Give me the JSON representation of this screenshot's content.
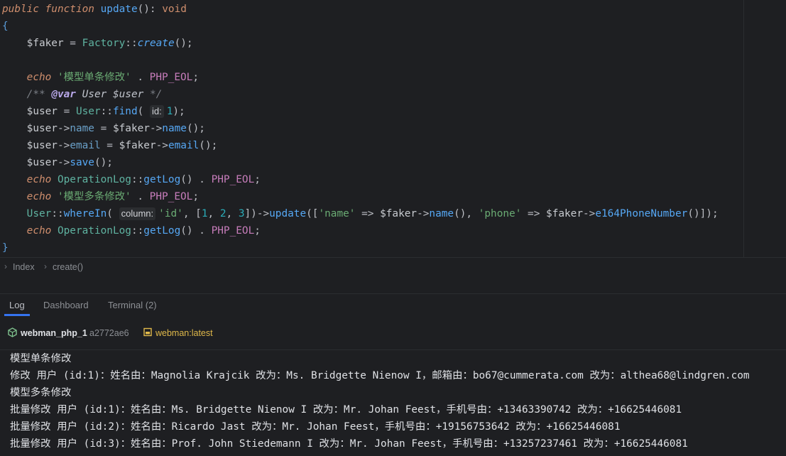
{
  "editor": {
    "lines": [
      [
        [
          "kw",
          "public function "
        ],
        [
          "fn",
          "update"
        ],
        [
          "op",
          "(): "
        ],
        [
          "tp",
          "void"
        ]
      ],
      [
        [
          "brace",
          "{"
        ]
      ],
      [
        [
          "op",
          "    "
        ],
        [
          "var",
          "$faker"
        ],
        [
          "op",
          " = "
        ],
        [
          "cls",
          "Factory"
        ],
        [
          "op",
          "::"
        ],
        [
          "smth",
          "create"
        ],
        [
          "op",
          "();"
        ]
      ],
      [],
      [
        [
          "op",
          "    "
        ],
        [
          "kw",
          "echo"
        ],
        [
          "op",
          " "
        ],
        [
          "str",
          "'模型单条修改'"
        ],
        [
          "op",
          " . "
        ],
        [
          "cst",
          "PHP_EOL"
        ],
        [
          "op",
          ";"
        ]
      ],
      [
        [
          "op",
          "    "
        ],
        [
          "cm",
          "/** "
        ],
        [
          "tag",
          "@var"
        ],
        [
          "cmtype",
          " User $user"
        ],
        [
          "cm",
          " */"
        ]
      ],
      [
        [
          "op",
          "    "
        ],
        [
          "var",
          "$user"
        ],
        [
          "op",
          " = "
        ],
        [
          "cls",
          "User"
        ],
        [
          "op",
          "::"
        ],
        [
          "mth",
          "find"
        ],
        [
          "op",
          "( "
        ],
        [
          "hint",
          "id:"
        ],
        [
          "num",
          "1"
        ],
        [
          "op",
          ");"
        ]
      ],
      [
        [
          "op",
          "    "
        ],
        [
          "var",
          "$user"
        ],
        [
          "arr",
          "->"
        ],
        [
          "prop",
          "name"
        ],
        [
          "op",
          " = "
        ],
        [
          "var",
          "$faker"
        ],
        [
          "arr",
          "->"
        ],
        [
          "mth",
          "name"
        ],
        [
          "op",
          "();"
        ]
      ],
      [
        [
          "op",
          "    "
        ],
        [
          "var",
          "$user"
        ],
        [
          "arr",
          "->"
        ],
        [
          "prop",
          "email"
        ],
        [
          "op",
          " = "
        ],
        [
          "var",
          "$faker"
        ],
        [
          "arr",
          "->"
        ],
        [
          "mth",
          "email"
        ],
        [
          "op",
          "();"
        ]
      ],
      [
        [
          "op",
          "    "
        ],
        [
          "var",
          "$user"
        ],
        [
          "arr",
          "->"
        ],
        [
          "mth",
          "save"
        ],
        [
          "op",
          "();"
        ]
      ],
      [
        [
          "op",
          "    "
        ],
        [
          "kw",
          "echo"
        ],
        [
          "op",
          " "
        ],
        [
          "cls",
          "OperationLog"
        ],
        [
          "op",
          "::"
        ],
        [
          "mth",
          "getLog"
        ],
        [
          "op",
          "() . "
        ],
        [
          "cst",
          "PHP_EOL"
        ],
        [
          "op",
          ";"
        ]
      ],
      [
        [
          "op",
          "    "
        ],
        [
          "kw",
          "echo"
        ],
        [
          "op",
          " "
        ],
        [
          "str",
          "'模型多条修改'"
        ],
        [
          "op",
          " . "
        ],
        [
          "cst",
          "PHP_EOL"
        ],
        [
          "op",
          ";"
        ]
      ],
      [
        [
          "op",
          "    "
        ],
        [
          "cls",
          "User"
        ],
        [
          "op",
          "::"
        ],
        [
          "mth",
          "whereIn"
        ],
        [
          "op",
          "( "
        ],
        [
          "hint",
          "column:"
        ],
        [
          "str",
          "'id'"
        ],
        [
          "op",
          ", ["
        ],
        [
          "num",
          "1"
        ],
        [
          "op",
          ", "
        ],
        [
          "num",
          "2"
        ],
        [
          "op",
          ", "
        ],
        [
          "num",
          "3"
        ],
        [
          "op",
          "])"
        ],
        [
          "arr",
          "->"
        ],
        [
          "mth",
          "update"
        ],
        [
          "op",
          "(["
        ],
        [
          "str",
          "'name'"
        ],
        [
          "op",
          " => "
        ],
        [
          "var",
          "$faker"
        ],
        [
          "arr",
          "->"
        ],
        [
          "mth",
          "name"
        ],
        [
          "op",
          "(), "
        ],
        [
          "str",
          "'phone'"
        ],
        [
          "op",
          " => "
        ],
        [
          "var",
          "$faker"
        ],
        [
          "arr",
          "->"
        ],
        [
          "mth",
          "e164PhoneNumber"
        ],
        [
          "op",
          "()]);"
        ]
      ],
      [
        [
          "op",
          "    "
        ],
        [
          "kw",
          "echo"
        ],
        [
          "op",
          " "
        ],
        [
          "cls",
          "OperationLog"
        ],
        [
          "op",
          "::"
        ],
        [
          "mth",
          "getLog"
        ],
        [
          "op",
          "() . "
        ],
        [
          "cst",
          "PHP_EOL"
        ],
        [
          "op",
          ";"
        ]
      ],
      [
        [
          "brace",
          "}"
        ]
      ]
    ]
  },
  "breadcrumb": {
    "items": [
      "Index",
      "create()"
    ]
  },
  "toolbar": {
    "tabs": [
      "Log",
      "Dashboard",
      "Terminal (2)"
    ],
    "active": 0
  },
  "panel": {
    "container_name": "webman_php_1",
    "container_id": "a2772ae6",
    "image_name": "webman:latest"
  },
  "log": {
    "lines": [
      "模型单条修改",
      "修改 用户 (id:1)：姓名由：Magnolia Krajcik 改为：Ms. Bridgette Nienow I，邮箱由：bo67@cummerata.com 改为：althea68@lindgren.com",
      "模型多条修改",
      "批量修改 用户 (id:1)：姓名由：Ms. Bridgette Nienow I 改为：Mr. Johan Feest，手机号由：+13463390742 改为：+16625446081",
      "批量修改 用户 (id:2)：姓名由：Ricardo Jast 改为：Mr. Johan Feest，手机号由：+19156753642 改为：+16625446081",
      "批量修改 用户 (id:3)：姓名由：Prof. John Stiedemann I 改为：Mr. Johan Feest，手机号由：+13257237461 改为：+16625446081"
    ]
  },
  "colors": {
    "background": "#1e1f22",
    "accent": "#3574f0",
    "container_icon": "#7fc28e",
    "image_icon": "#e0b94a"
  },
  "icons": [
    "container-icon",
    "image-icon",
    "chevron-right-icon"
  ]
}
